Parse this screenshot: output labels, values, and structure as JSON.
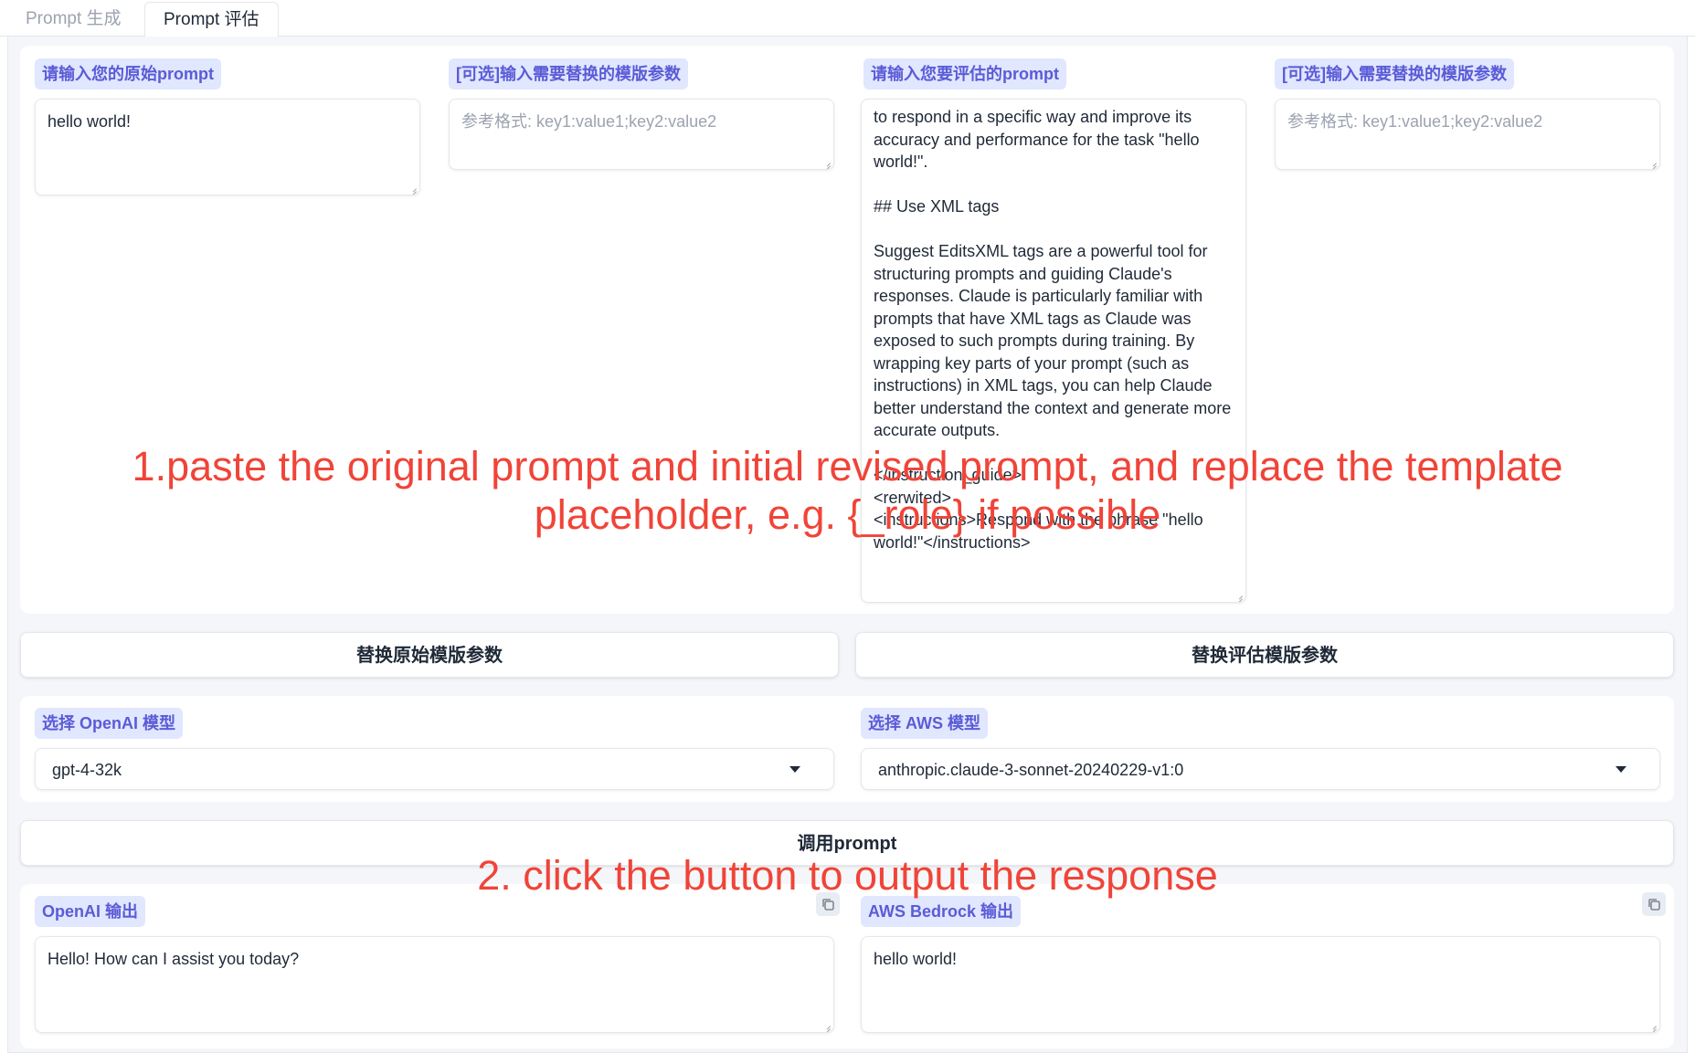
{
  "tabs": [
    {
      "label": "Prompt 生成"
    },
    {
      "label": "Prompt 评估"
    }
  ],
  "row1": {
    "original_prompt": {
      "label": "请输入您的原始prompt",
      "value": "hello world!"
    },
    "original_params": {
      "label": "[可选]输入需要替换的模版参数",
      "placeholder": "参考格式: key1:value1;key2:value2"
    },
    "eval_prompt": {
      "label": "请输入您要评估的prompt",
      "value": "to respond in a specific way and improve its accuracy and performance for the task \"hello world!\".\n\n## Use XML tags\n\nSuggest EditsXML tags are a powerful tool for structuring prompts and guiding Claude's responses. Claude is particularly familiar with prompts that have XML tags as Claude was exposed to such prompts during training. By wrapping key parts of your prompt (such as instructions) in XML tags, you can help Claude better understand the context and generate more accurate outputs.\n\n</instruction_guide>\n<rerwited>\n<instructions>Respond with the phrase \"hello world!\"</instructions>"
    },
    "eval_params": {
      "label": "[可选]输入需要替换的模版参数",
      "placeholder": "参考格式: key1:value1;key2:value2"
    }
  },
  "buttons": {
    "replace_original": "替换原始模版参数",
    "replace_eval": "替换评估模版参数",
    "invoke": "调用prompt"
  },
  "models": {
    "openai": {
      "label": "选择 OpenAI 模型",
      "value": "gpt-4-32k"
    },
    "aws": {
      "label": "选择 AWS 模型",
      "value": "anthropic.claude-3-sonnet-20240229-v1:0"
    }
  },
  "outputs": {
    "openai": {
      "label": "OpenAI 输出",
      "value": "Hello! How can I assist you today?"
    },
    "aws": {
      "label": "AWS Bedrock 输出",
      "value": "hello world!"
    }
  },
  "annotations": {
    "step1_line1": "1.paste the original prompt and initial revised prompt, and replace the template",
    "step1_line2": "placeholder, e.g. {_role} if possible",
    "step2": "2. click the button to output the response"
  },
  "colors": {
    "accent_label": "#5b5bd6",
    "label_bg": "#e0e7ff",
    "annotation": "#f04438",
    "frame_bg": "#f4f6f9"
  }
}
